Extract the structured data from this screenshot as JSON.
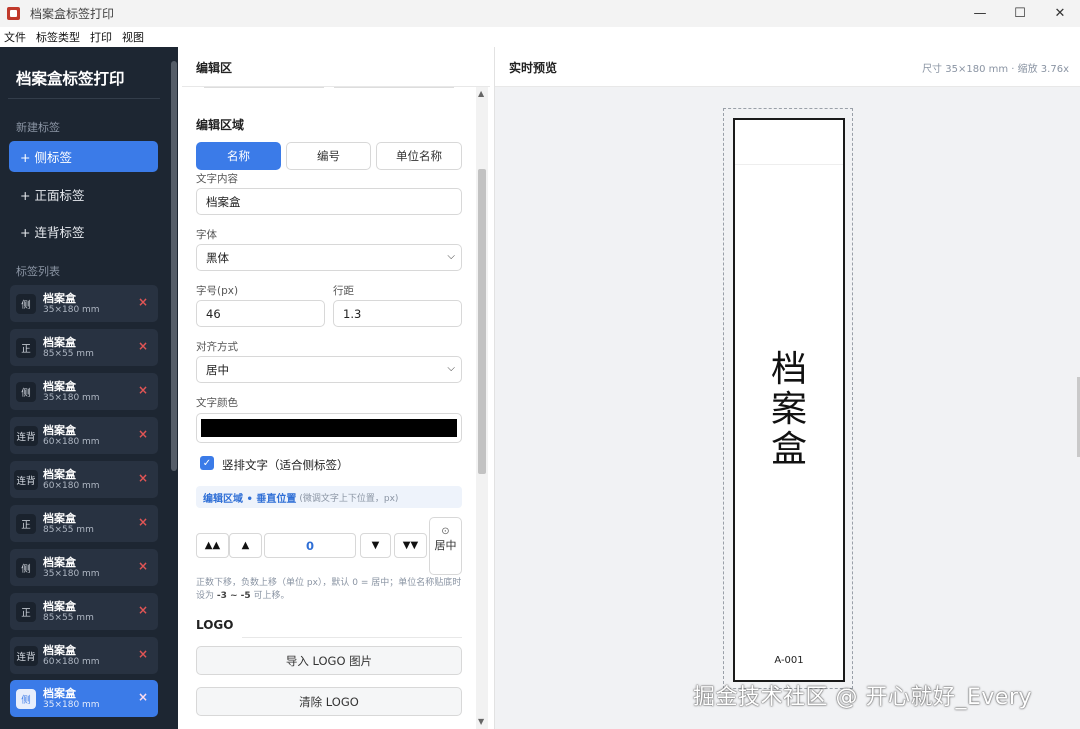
{
  "window": {
    "title": "档案盒标签打印",
    "controls": {
      "minimize": "—",
      "maximize": "☐",
      "close": "✕"
    }
  },
  "menu": [
    "文件",
    "标签类型",
    "打印",
    "视图"
  ],
  "sidebar": {
    "title": "档案盒标签打印",
    "new_section": "新建标签",
    "new_buttons": [
      "+ 侧标签",
      "+ 正面标签",
      "+ 连背标签"
    ],
    "list_section": "标签列表",
    "items": [
      {
        "badge": "侧",
        "name": "档案盒",
        "size": "35×180 mm"
      },
      {
        "badge": "正",
        "name": "档案盒",
        "size": "85×55 mm"
      },
      {
        "badge": "侧",
        "name": "档案盒",
        "size": "35×180 mm"
      },
      {
        "badge": "连背",
        "name": "档案盒",
        "size": "60×180 mm"
      },
      {
        "badge": "连背",
        "name": "档案盒",
        "size": "60×180 mm"
      },
      {
        "badge": "正",
        "name": "档案盒",
        "size": "85×55 mm"
      },
      {
        "badge": "侧",
        "name": "档案盒",
        "size": "35×180 mm"
      },
      {
        "badge": "正",
        "name": "档案盒",
        "size": "85×55 mm"
      },
      {
        "badge": "连背",
        "name": "档案盒",
        "size": "60×180 mm"
      },
      {
        "badge": "侧",
        "name": "档案盒",
        "size": "35×180 mm"
      }
    ],
    "delete_glyph": "×"
  },
  "editor": {
    "header": "编辑区",
    "area_title": "编辑区域",
    "tabs": [
      "名称",
      "编号",
      "单位名称"
    ],
    "text_label": "文字内容",
    "text_value": "档案盒",
    "font_label": "字体",
    "font_value": "黑体",
    "size_label": "字号(px)",
    "size_value": "46",
    "line_label": "行距",
    "line_value": "1.3",
    "align_label": "对齐方式",
    "align_value": "居中",
    "color_label": "文字颜色",
    "text_color": "#000000",
    "vertical_label": "竖排文字（适合侧标签）",
    "info_strong": "编辑区域 • 垂直位置",
    "info_hint": "(微调文字上下位置，px)",
    "nudge": {
      "up_big": "▲▲",
      "up": "▲",
      "value": "0",
      "down": "▼",
      "down_big": "▼▼"
    },
    "center_icon": "⊙",
    "center_label": "居中",
    "note_pre": "正数下移，负数上移（单位 px），默认 0 = 居中；单位名称贴底时设为 ",
    "note_range": "-3 ~ -5",
    "note_post": " 可上移。",
    "logo_title": "LOGO",
    "import_logo": "导入 LOGO 图片",
    "clear_logo": "清除 LOGO"
  },
  "preview": {
    "title": "实时预览",
    "meta": "尺寸 35×180 mm · 缩放 3.76x",
    "label_chars": [
      "档",
      "案",
      "盒"
    ],
    "label_code": "A-001"
  },
  "watermark": "掘金技术社区 @ 开心就好_Every",
  "colors": {
    "accent": "#3b7be8",
    "sidebar_bg": "#1d2632",
    "delete": "#e25555"
  }
}
